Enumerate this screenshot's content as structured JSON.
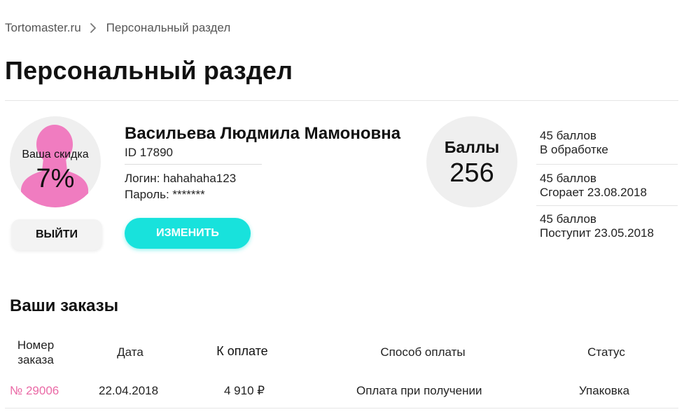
{
  "breadcrumb": {
    "home": "Tortomaster.ru",
    "current": "Персональный раздел"
  },
  "page_title": "Персональный раздел",
  "profile": {
    "discount_label": "Ваша скидка",
    "discount_value": "7%",
    "avatar_color": "#f07cc0",
    "logout_label": "ВЫЙТИ",
    "name": "Васильева Людмила Мамоновна",
    "id_text": "ID 17890",
    "login_text": "Логин: hahahaha123",
    "password_text": "Пароль: *******",
    "edit_label": "ИЗМЕНИТЬ",
    "edit_color": "#18e2dc"
  },
  "points": {
    "label": "Баллы",
    "value": "256",
    "items": [
      {
        "amount": "45 баллов",
        "status": "В обработке"
      },
      {
        "amount": "45 баллов",
        "status": "Сгорает 23.08.2018"
      },
      {
        "amount": "45 баллов",
        "status": "Поступит 23.05.2018"
      }
    ]
  },
  "orders": {
    "title": "Ваши заказы",
    "columns": {
      "number_line1": "Номер",
      "number_line2": "заказа",
      "date": "Дата",
      "amount": "К оплате",
      "payment": "Способ оплаты",
      "status": "Статус"
    },
    "rows": [
      {
        "number": "№ 29006",
        "date": "22.04.2018",
        "amount": "4 910 ₽",
        "payment": "Оплата при получении",
        "status": "Упаковка"
      }
    ],
    "link_color": "#ea6aa6"
  }
}
